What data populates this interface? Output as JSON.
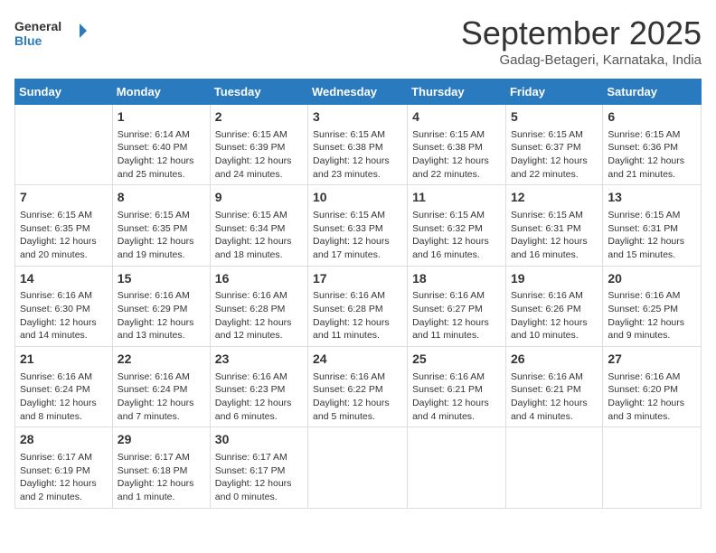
{
  "logo": {
    "line1": "General",
    "line2": "Blue"
  },
  "title": "September 2025",
  "subtitle": "Gadag-Betageri, Karnataka, India",
  "days_of_week": [
    "Sunday",
    "Monday",
    "Tuesday",
    "Wednesday",
    "Thursday",
    "Friday",
    "Saturday"
  ],
  "weeks": [
    [
      {
        "day": "",
        "info": ""
      },
      {
        "day": "1",
        "info": "Sunrise: 6:14 AM\nSunset: 6:40 PM\nDaylight: 12 hours\nand 25 minutes."
      },
      {
        "day": "2",
        "info": "Sunrise: 6:15 AM\nSunset: 6:39 PM\nDaylight: 12 hours\nand 24 minutes."
      },
      {
        "day": "3",
        "info": "Sunrise: 6:15 AM\nSunset: 6:38 PM\nDaylight: 12 hours\nand 23 minutes."
      },
      {
        "day": "4",
        "info": "Sunrise: 6:15 AM\nSunset: 6:38 PM\nDaylight: 12 hours\nand 22 minutes."
      },
      {
        "day": "5",
        "info": "Sunrise: 6:15 AM\nSunset: 6:37 PM\nDaylight: 12 hours\nand 22 minutes."
      },
      {
        "day": "6",
        "info": "Sunrise: 6:15 AM\nSunset: 6:36 PM\nDaylight: 12 hours\nand 21 minutes."
      }
    ],
    [
      {
        "day": "7",
        "info": "Sunrise: 6:15 AM\nSunset: 6:35 PM\nDaylight: 12 hours\nand 20 minutes."
      },
      {
        "day": "8",
        "info": "Sunrise: 6:15 AM\nSunset: 6:35 PM\nDaylight: 12 hours\nand 19 minutes."
      },
      {
        "day": "9",
        "info": "Sunrise: 6:15 AM\nSunset: 6:34 PM\nDaylight: 12 hours\nand 18 minutes."
      },
      {
        "day": "10",
        "info": "Sunrise: 6:15 AM\nSunset: 6:33 PM\nDaylight: 12 hours\nand 17 minutes."
      },
      {
        "day": "11",
        "info": "Sunrise: 6:15 AM\nSunset: 6:32 PM\nDaylight: 12 hours\nand 16 minutes."
      },
      {
        "day": "12",
        "info": "Sunrise: 6:15 AM\nSunset: 6:31 PM\nDaylight: 12 hours\nand 16 minutes."
      },
      {
        "day": "13",
        "info": "Sunrise: 6:15 AM\nSunset: 6:31 PM\nDaylight: 12 hours\nand 15 minutes."
      }
    ],
    [
      {
        "day": "14",
        "info": "Sunrise: 6:16 AM\nSunset: 6:30 PM\nDaylight: 12 hours\nand 14 minutes."
      },
      {
        "day": "15",
        "info": "Sunrise: 6:16 AM\nSunset: 6:29 PM\nDaylight: 12 hours\nand 13 minutes."
      },
      {
        "day": "16",
        "info": "Sunrise: 6:16 AM\nSunset: 6:28 PM\nDaylight: 12 hours\nand 12 minutes."
      },
      {
        "day": "17",
        "info": "Sunrise: 6:16 AM\nSunset: 6:28 PM\nDaylight: 12 hours\nand 11 minutes."
      },
      {
        "day": "18",
        "info": "Sunrise: 6:16 AM\nSunset: 6:27 PM\nDaylight: 12 hours\nand 11 minutes."
      },
      {
        "day": "19",
        "info": "Sunrise: 6:16 AM\nSunset: 6:26 PM\nDaylight: 12 hours\nand 10 minutes."
      },
      {
        "day": "20",
        "info": "Sunrise: 6:16 AM\nSunset: 6:25 PM\nDaylight: 12 hours\nand 9 minutes."
      }
    ],
    [
      {
        "day": "21",
        "info": "Sunrise: 6:16 AM\nSunset: 6:24 PM\nDaylight: 12 hours\nand 8 minutes."
      },
      {
        "day": "22",
        "info": "Sunrise: 6:16 AM\nSunset: 6:24 PM\nDaylight: 12 hours\nand 7 minutes."
      },
      {
        "day": "23",
        "info": "Sunrise: 6:16 AM\nSunset: 6:23 PM\nDaylight: 12 hours\nand 6 minutes."
      },
      {
        "day": "24",
        "info": "Sunrise: 6:16 AM\nSunset: 6:22 PM\nDaylight: 12 hours\nand 5 minutes."
      },
      {
        "day": "25",
        "info": "Sunrise: 6:16 AM\nSunset: 6:21 PM\nDaylight: 12 hours\nand 4 minutes."
      },
      {
        "day": "26",
        "info": "Sunrise: 6:16 AM\nSunset: 6:21 PM\nDaylight: 12 hours\nand 4 minutes."
      },
      {
        "day": "27",
        "info": "Sunrise: 6:16 AM\nSunset: 6:20 PM\nDaylight: 12 hours\nand 3 minutes."
      }
    ],
    [
      {
        "day": "28",
        "info": "Sunrise: 6:17 AM\nSunset: 6:19 PM\nDaylight: 12 hours\nand 2 minutes."
      },
      {
        "day": "29",
        "info": "Sunrise: 6:17 AM\nSunset: 6:18 PM\nDaylight: 12 hours\nand 1 minute."
      },
      {
        "day": "30",
        "info": "Sunrise: 6:17 AM\nSunset: 6:17 PM\nDaylight: 12 hours\nand 0 minutes."
      },
      {
        "day": "",
        "info": ""
      },
      {
        "day": "",
        "info": ""
      },
      {
        "day": "",
        "info": ""
      },
      {
        "day": "",
        "info": ""
      }
    ]
  ]
}
